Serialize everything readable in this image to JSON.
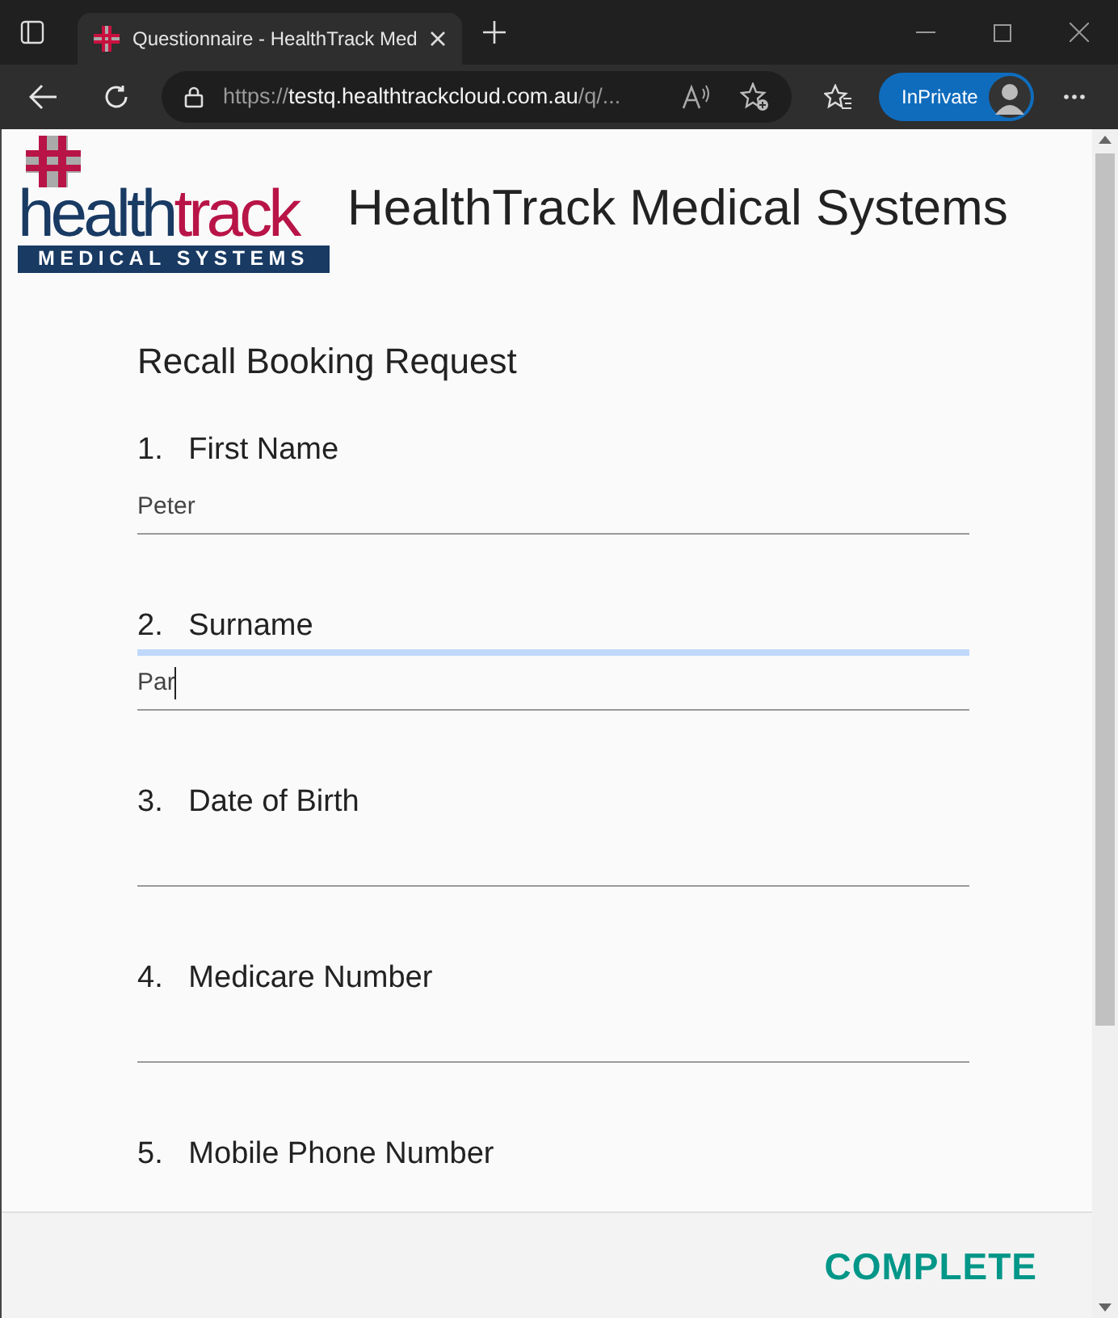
{
  "browser": {
    "tab_title": "Questionnaire - HealthTrack Med",
    "url_prefix": "https://",
    "url_host": "testq.healthtrackcloud.com.au",
    "url_path": "/q/...",
    "profile_label": "InPrivate"
  },
  "logo": {
    "word_1": "health",
    "word_2": "track",
    "tagline": "MEDICAL SYSTEMS"
  },
  "header_title": "HealthTrack Medical Systems",
  "form_title": "Recall Booking Request",
  "questions": [
    {
      "number": "1.",
      "label": "First Name",
      "value": "Peter",
      "focused": false
    },
    {
      "number": "2.",
      "label": "Surname",
      "value": "Par",
      "focused": true
    },
    {
      "number": "3.",
      "label": "Date of Birth",
      "focused": false
    },
    {
      "number": "4.",
      "label": "Medicare Number",
      "focused": false
    },
    {
      "number": "5.",
      "label": "Mobile Phone Number",
      "focused": false
    }
  ],
  "complete_button": "COMPLETE"
}
